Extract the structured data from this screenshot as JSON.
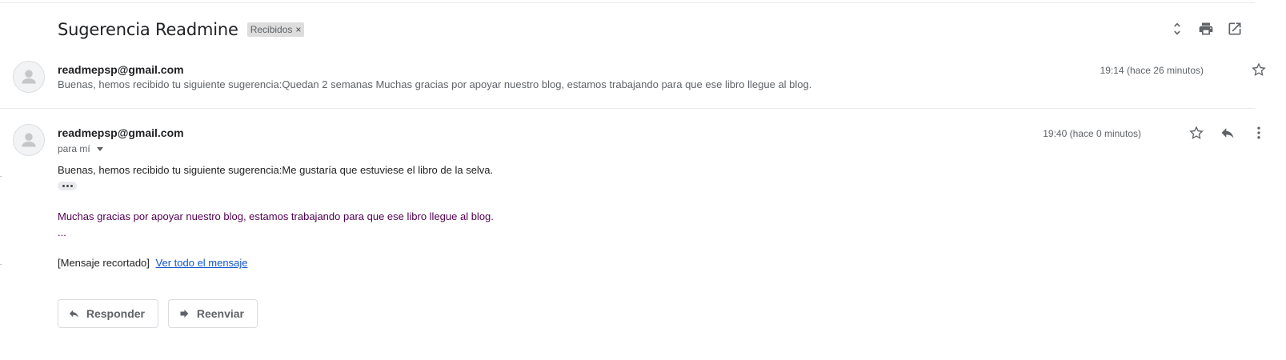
{
  "thread": {
    "subject": "Sugerencia Readmine",
    "label": "Recibidos",
    "label_remove": "×"
  },
  "toolbar": {
    "icons": [
      "expand-collapse-icon",
      "print-icon",
      "open-in-new-window-icon"
    ]
  },
  "messages": [
    {
      "sender": "readmepsp@gmail.com",
      "time": "19:14 (hace 26 minutos)",
      "snippet": "Buenas, hemos recibido tu siguiente sugerencia:Quedan 2 semanas Muchas gracias por apoyar nuestro blog, estamos trabajando para que ese libro llegue al blog."
    },
    {
      "sender": "readmepsp@gmail.com",
      "time": "19:40 (hace 0 minutos)",
      "to": "para mí",
      "body_line1": "Buenas, hemos recibido tu siguiente sugerencia:Me gustaría que estuviese el libro de la selva.",
      "body_line2": "Muchas gracias por apoyar nuestro blog, estamos trabajando para que ese libro llegue al blog.",
      "body_dots": "...",
      "clipped_text": "[Mensaje recortado]",
      "view_all_link": "Ver todo el mensaje"
    }
  ],
  "actions": {
    "reply_label": "Responder",
    "forward_label": "Reenviar"
  },
  "colors": {
    "quoted_text": "#500050",
    "link": "#1155cc",
    "label_chip_bg": "#dddddd"
  }
}
